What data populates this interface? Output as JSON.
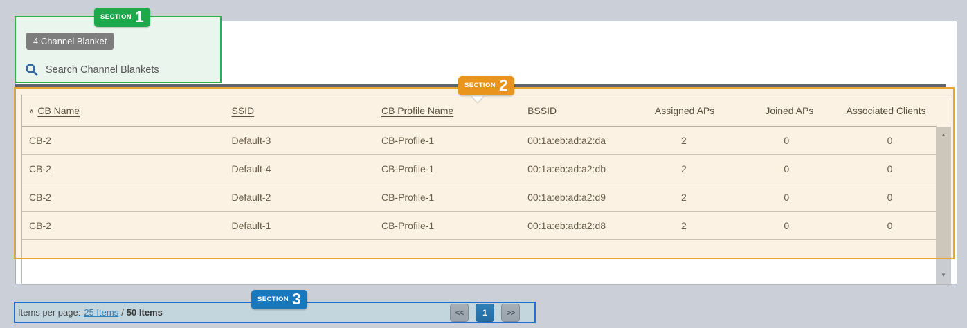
{
  "annotations": {
    "sections": [
      {
        "label": "SECTION",
        "number": "1",
        "color": "#1fa84b"
      },
      {
        "label": "SECTION",
        "number": "2",
        "color": "#e8941d"
      },
      {
        "label": "SECTION",
        "number": "3",
        "color": "#1878be"
      }
    ]
  },
  "panel": {
    "count_chip": "4 Channel Blanket",
    "search_placeholder": "Search Channel Blankets",
    "search_icon": "magnifier-icon"
  },
  "table": {
    "sort_indicator": "∧",
    "columns": [
      {
        "label": "CB Name",
        "sortable": true,
        "sorted": "asc"
      },
      {
        "label": "SSID",
        "sortable": true
      },
      {
        "label": "CB Profile Name",
        "sortable": true
      },
      {
        "label": "BSSID",
        "sortable": false
      },
      {
        "label": "Assigned APs",
        "sortable": false
      },
      {
        "label": "Joined APs",
        "sortable": false
      },
      {
        "label": "Associated Clients",
        "sortable": false
      }
    ],
    "rows": [
      [
        "CB-2",
        "Default-3",
        "CB-Profile-1",
        "00:1a:eb:ad:a2:da",
        "2",
        "0",
        "0"
      ],
      [
        "CB-2",
        "Default-4",
        "CB-Profile-1",
        "00:1a:eb:ad:a2:db",
        "2",
        "0",
        "0"
      ],
      [
        "CB-2",
        "Default-2",
        "CB-Profile-1",
        "00:1a:eb:ad:a2:d9",
        "2",
        "0",
        "0"
      ],
      [
        "CB-2",
        "Default-1",
        "CB-Profile-1",
        "00:1a:eb:ad:a2:d8",
        "2",
        "0",
        "0"
      ]
    ]
  },
  "scrollbar": {
    "up_icon": "▲",
    "down_icon": "▼"
  },
  "pagination": {
    "items_per_page_label": "Items per page:",
    "page_size_link": "25 Items",
    "separator": "/",
    "total_items": "50 Items",
    "prev_label": "<<",
    "current_page": "1",
    "next_label": ">>"
  },
  "colors": {
    "section1_green": "#2bb051",
    "section2_orange": "#e9a62e",
    "section3_blue": "#1f6fd2",
    "chip_gray": "#7d7d7d",
    "link_blue": "#2e7fb8",
    "active_page_blue": "#2776ae",
    "search_icon_blue": "#38699e",
    "divider_slate": "#5c6670",
    "page_background": "#cbd0d8"
  }
}
